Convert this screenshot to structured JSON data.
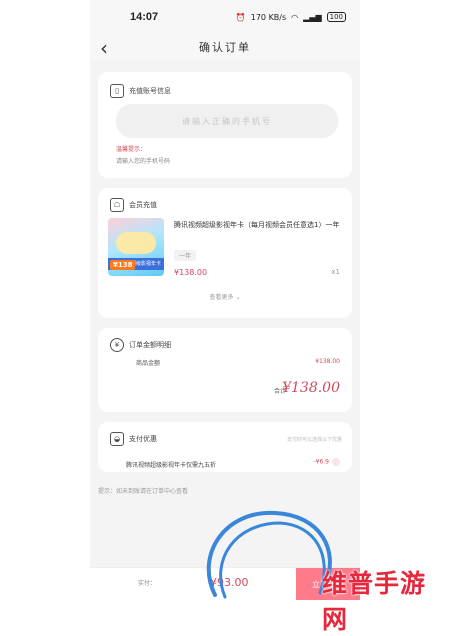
{
  "statusbar": {
    "time": "14:07",
    "net_speed": "170 KB/s",
    "battery": "100"
  },
  "header": {
    "title": "确认订单"
  },
  "account_card": {
    "title": "充值账号信息",
    "input_placeholder": "请输入正确的手机号",
    "tip_title": "温馨提示：",
    "tip_body": "请输入您的手机号码"
  },
  "product_card": {
    "title": "会员充值",
    "name": "腾讯视频超级影视年卡（每月视频会员任意选1）一年",
    "spec": "一年",
    "price": "¥138.00",
    "qty": "x1",
    "image_tag": "¥138",
    "image_band": "超级影视年卡",
    "more_label": "查看更多"
  },
  "amount_card": {
    "title": "订单金额明细",
    "goods_label": "商品金额",
    "goods_value": "¥138.00",
    "total_label": "合计",
    "total_value": "¥138.00"
  },
  "gift_card": {
    "title": "支付优惠",
    "note": "支付时可以选择以下优惠",
    "item": "腾讯视频超级影视年卡仅需九五折",
    "badge": "-¥6.9"
  },
  "footnote": "提示：如未到账请在订单中心查看",
  "bottom_bar": {
    "pay_label": "实付：",
    "pay_price": "¥93.00",
    "pay_button": "立即支付"
  },
  "watermark": "维普手游网",
  "colors": {
    "accent": "#d1495b",
    "button": "#ff7a8a"
  }
}
